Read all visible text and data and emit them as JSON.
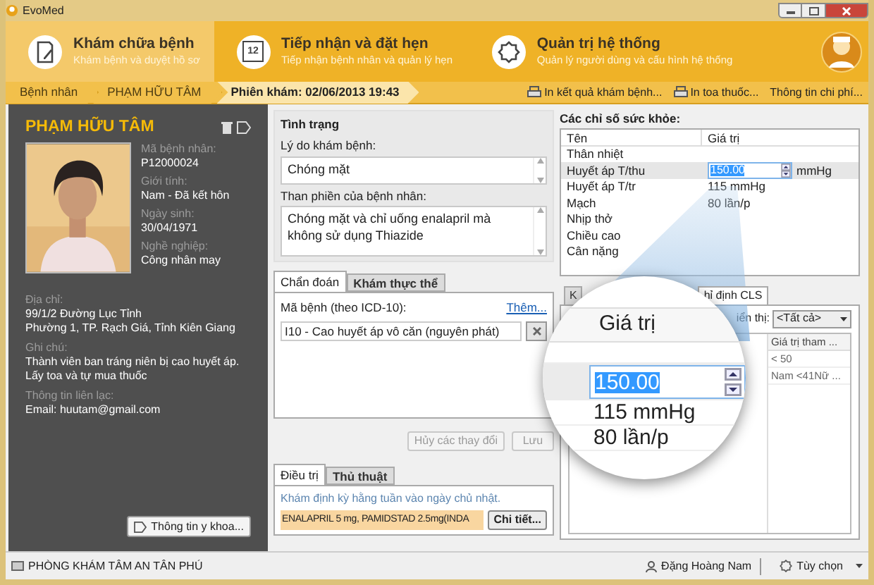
{
  "window": {
    "title": "EvoMed"
  },
  "modules": [
    {
      "title": "Khám chữa bệnh",
      "subtitle": "Khám bệnh và duyệt hồ sơ",
      "kind": "notes",
      "selected": true
    },
    {
      "title": "Tiếp nhận và đặt hẹn",
      "subtitle": "Tiếp nhận bệnh nhân và quản lý hẹn",
      "kind": "calendar",
      "selected": false
    },
    {
      "title": "Quản trị hệ thống",
      "subtitle": "Quản lý người dùng và cấu hình hệ thống",
      "kind": "gear",
      "selected": false
    }
  ],
  "calendar_day": "12",
  "breadcrumb": [
    {
      "label": "Bệnh nhân",
      "selected": false
    },
    {
      "label": "PHẠM HỮU TÂM",
      "selected": false
    },
    {
      "label": "Phiên khám: 02/06/2013 19:43",
      "selected": true
    }
  ],
  "toolbar_actions": [
    {
      "label": "In kết quả khám bệnh...",
      "kind": "print"
    },
    {
      "label": "In toa thuốc...",
      "kind": "print"
    },
    {
      "label": "Thông tin chi phí...",
      "kind": "plain"
    }
  ],
  "patient": {
    "name": "PHẠM HỮU TÂM",
    "fields": [
      {
        "label": "Mã bệnh nhân:",
        "value": "P12000024"
      },
      {
        "label": "Giới tính:",
        "value": "Nam - Đã kết hôn"
      },
      {
        "label": "Ngày sinh:",
        "value": "30/04/1971"
      },
      {
        "label": "Nghề nghiệp:",
        "value": "Công nhân may"
      }
    ],
    "details": [
      {
        "label": "Địa chỉ:",
        "lines": [
          "99/1/2 Đường Lục Tỉnh",
          "Phường 1, TP. Rạch Giá, Tỉnh Kiên Giang"
        ]
      },
      {
        "label": "Ghi chú:",
        "lines": [
          "Thành viên ban tráng niên bị cao huyết áp. Lấy toa và tự mua thuốc"
        ]
      },
      {
        "label": "Thông tin liên lạc:",
        "lines": [
          "Email: huutam@gmail.com"
        ]
      }
    ],
    "button": "Thông tin y khoa..."
  },
  "condition": {
    "title": "Tình trạng",
    "fields": [
      {
        "label": "Lý do khám bệnh:",
        "value": "Chóng mặt"
      },
      {
        "label": "Than phiền của bệnh nhân:",
        "value": "Chóng mặt và chỉ uống enalapril mà không sử dụng Thiazide"
      }
    ]
  },
  "diagnosis": {
    "tabs": [
      {
        "label": "Chẩn đoán",
        "selected": true
      },
      {
        "label": "Khám thực thể",
        "selected": false
      }
    ],
    "code_label": "Mã bệnh (theo ICD-10):",
    "add_link": "Thêm...",
    "entries": [
      "I10 - Cao huyết áp vô căn (nguyên phát)"
    ]
  },
  "actions": [
    {
      "label": "Hủy các thay đổi",
      "disabled": true
    },
    {
      "label": "Lưu",
      "disabled": true
    }
  ],
  "treatment": {
    "tabs": [
      {
        "label": "Điều trị",
        "selected": true
      },
      {
        "label": "Thủ thuật",
        "selected": false
      }
    ],
    "note": "Khám định kỳ hằng tuần vào ngày chủ nhật.",
    "drugs": "ENALAPRIL 5 mg, PAMIDSTAD 2.5mg(INDA",
    "button": "Chi tiết..."
  },
  "vitals": {
    "title": "Các chỉ số sức khỏe:",
    "columns": [
      "Tên",
      "Giá trị"
    ],
    "rows": [
      {
        "name": "Thân nhiệt",
        "kind": "text",
        "selected": false
      },
      {
        "name": "Huyết áp T/thu",
        "kind": "spin",
        "value": "150.00",
        "unit": "mmHg",
        "selected": true
      },
      {
        "name": "Huyết áp T/tr",
        "kind": "text",
        "value": "115 mmHg",
        "selected": false
      },
      {
        "name": "Mạch",
        "kind": "text",
        "value": "80 lần/p",
        "selected": false
      },
      {
        "name": "Nhịp thở",
        "kind": "text",
        "selected": false
      },
      {
        "name": "Chiều cao",
        "kind": "text",
        "selected": false
      },
      {
        "name": "Cân nặng",
        "kind": "text",
        "selected": false
      }
    ]
  },
  "lab": {
    "tabs": [
      {
        "label": "K",
        "selected": false
      },
      {
        "label": "hỉ định CLS",
        "selected": true
      }
    ],
    "filter_label": "iển thị:",
    "filter_value": "<Tất cả>",
    "column": "Giá trị tham ...",
    "cells": [
      "< 50",
      "Nam <41Nữ ..."
    ]
  },
  "magnifier": {
    "header": "Giá trị",
    "spin_value": "150.00",
    "rows": [
      "115 mmHg",
      "80 lần/p"
    ]
  },
  "status_bar": {
    "clinic": "PHÒNG KHÁM TÂM AN TÂN PHÚ",
    "user": "Đặng Hoàng Nam",
    "options": "Tùy chọn"
  }
}
